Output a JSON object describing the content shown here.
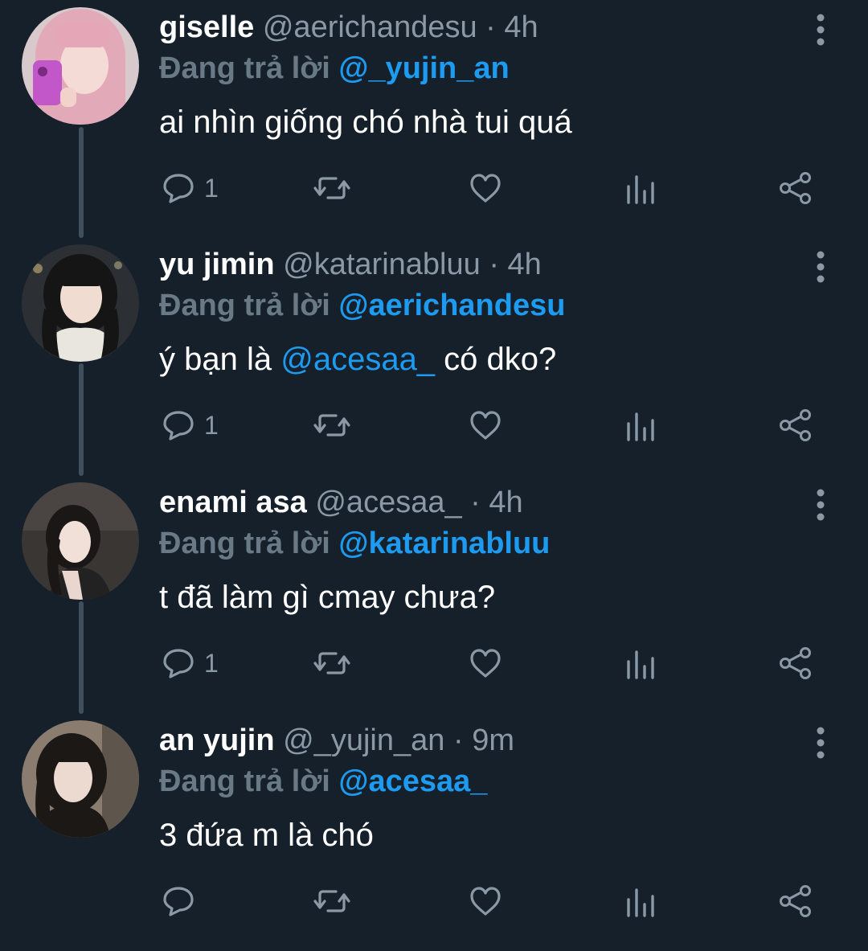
{
  "colors": {
    "background": "#15202b",
    "accent_link": "#1d9bf0",
    "secondary_text": "#8b98a5",
    "thread_line": "#3f4f5e"
  },
  "tweets": [
    {
      "name": "giselle",
      "handle": "@aerichandesu",
      "dot": "·",
      "time": "4h",
      "reply_label": "Đang trả lời",
      "reply_to": "@_yujin_an",
      "text_before": "ai nhìn giống chó nhà tui quá",
      "mention": "",
      "text_after": "",
      "reply_count": "1",
      "icons": [
        "reply-icon",
        "retweet-icon",
        "like-icon",
        "analytics-icon",
        "share-icon",
        "more-icon"
      ]
    },
    {
      "name": "yu jimin",
      "handle": "@katarinabluu",
      "dot": "·",
      "time": "4h",
      "reply_label": "Đang trả lời",
      "reply_to": "@aerichandesu",
      "text_before": "ý bạn là ",
      "mention": "@acesaa_",
      "text_after": " có dko?",
      "reply_count": "1",
      "icons": [
        "reply-icon",
        "retweet-icon",
        "like-icon",
        "analytics-icon",
        "share-icon",
        "more-icon"
      ]
    },
    {
      "name": "enami asa",
      "handle": "@acesaa_",
      "dot": "·",
      "time": "4h",
      "reply_label": "Đang trả lời",
      "reply_to": "@katarinabluu",
      "text_before": "t đã làm gì cmay chưa?",
      "mention": "",
      "text_after": "",
      "reply_count": "1",
      "icons": [
        "reply-icon",
        "retweet-icon",
        "like-icon",
        "analytics-icon",
        "share-icon",
        "more-icon"
      ]
    },
    {
      "name": "an yujin",
      "handle": "@_yujin_an",
      "dot": "·",
      "time": "9m",
      "reply_label": "Đang trả lời",
      "reply_to": "@acesaa_",
      "text_before": "3 đứa m là chó",
      "mention": "",
      "text_after": "",
      "reply_count": "",
      "icons": [
        "reply-icon",
        "retweet-icon",
        "like-icon",
        "analytics-icon",
        "share-icon",
        "more-icon"
      ]
    }
  ]
}
